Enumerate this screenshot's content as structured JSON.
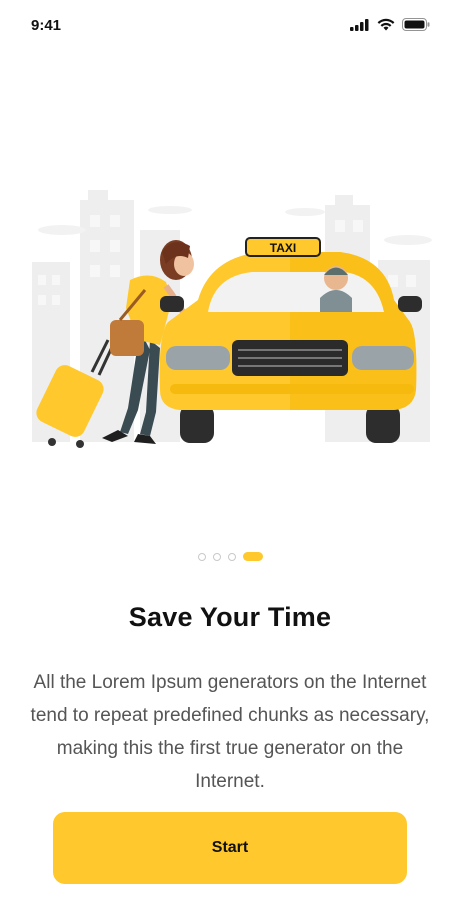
{
  "status": {
    "time": "9:41"
  },
  "illustration": {
    "sign_text": "TAXI"
  },
  "pager": {
    "count": 4,
    "active_index": 3
  },
  "onboarding": {
    "title": "Save Your Time",
    "description": "All the Lorem Ipsum generators on the Internet tend to repeat predefined chunks as necessary, making this the first true generator on the Internet.",
    "start_label": "Start"
  },
  "colors": {
    "accent": "#ffc82c",
    "text_dark": "#111111",
    "text_muted": "#555555"
  }
}
